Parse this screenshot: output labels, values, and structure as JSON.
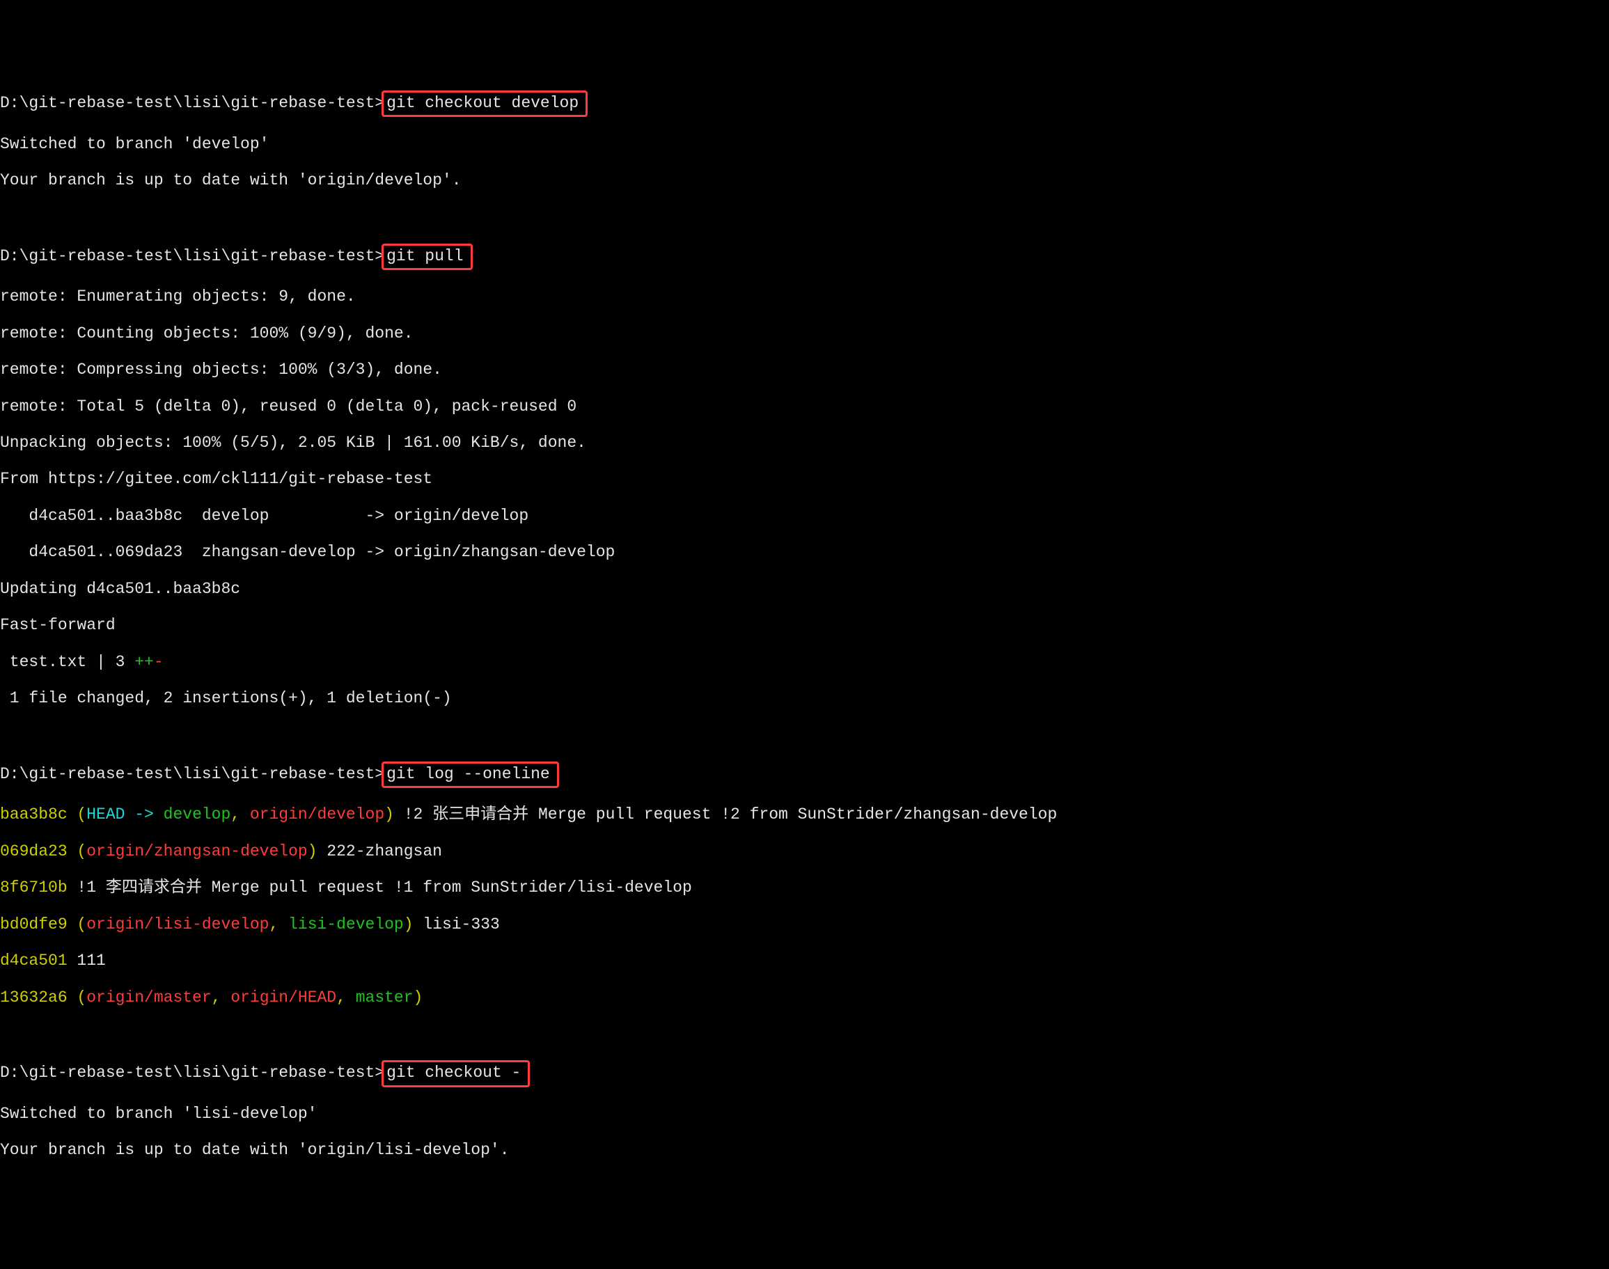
{
  "prompt": "D:\\git-rebase-test\\lisi\\git-rebase-test>",
  "cmd1": "git checkout develop",
  "out1_l1": "Switched to branch 'develop'",
  "out1_l2": "Your branch is up to date with 'origin/develop'.",
  "cmd2": "git pull",
  "out2_l1": "remote: Enumerating objects: 9, done.",
  "out2_l2": "remote: Counting objects: 100% (9/9), done.",
  "out2_l3": "remote: Compressing objects: 100% (3/3), done.",
  "out2_l4": "remote: Total 5 (delta 0), reused 0 (delta 0), pack-reused 0",
  "out2_l5": "Unpacking objects: 100% (5/5), 2.05 KiB | 161.00 KiB/s, done.",
  "out2_l6": "From https://gitee.com/ckl111/git-rebase-test",
  "out2_l7": "   d4ca501..baa3b8c  develop          -> origin/develop",
  "out2_l8": "   d4ca501..069da23  zhangsan-develop -> origin/zhangsan-develop",
  "out2_l9": "Updating d4ca501..baa3b8c",
  "out2_l10": "Fast-forward",
  "out2_l11a": " test.txt | 3 ",
  "out2_l11_plus": "++",
  "out2_l11_minus": "-",
  "out2_l12": " 1 file changed, 2 insertions(+), 1 deletion(-)",
  "cmd3": "git log --oneline",
  "log1_hash": "baa3b8c",
  "log1_p1": " (",
  "log1_head": "HEAD -> ",
  "log1_branch": "develop",
  "log1_sep": ", ",
  "log1_origin": "origin/develop",
  "log1_p2": ")",
  "log1_msg": " !2 张三申请合并 Merge pull request !2 from SunStrider/zhangsan-develop",
  "log2_hash": "069da23",
  "log2_p1": " (",
  "log2_origin": "origin/zhangsan-develop",
  "log2_p2": ")",
  "log2_msg": " 222-zhangsan",
  "log3_hash": "8f6710b",
  "log3_msg": " !1 李四请求合并 Merge pull request !1 from SunStrider/lisi-develop",
  "log4_hash": "bd0dfe9",
  "log4_p1": " (",
  "log4_origin": "origin/lisi-develop",
  "log4_sep": ", ",
  "log4_local": "lisi-develop",
  "log4_p2": ")",
  "log4_msg": " lisi-333",
  "log5_hash": "d4ca501",
  "log5_msg": " 111",
  "log6_hash": "13632a6",
  "log6_p1": " (",
  "log6_r1": "origin/master",
  "log6_sep1": ", ",
  "log6_r2": "origin/HEAD",
  "log6_sep2": ", ",
  "log6_r3": "master",
  "log6_p2": ")",
  "cmd4": "git checkout -",
  "out4_l1": "Switched to branch 'lisi-develop'",
  "out4_l2": "Your branch is up to date with 'origin/lisi-develop'."
}
